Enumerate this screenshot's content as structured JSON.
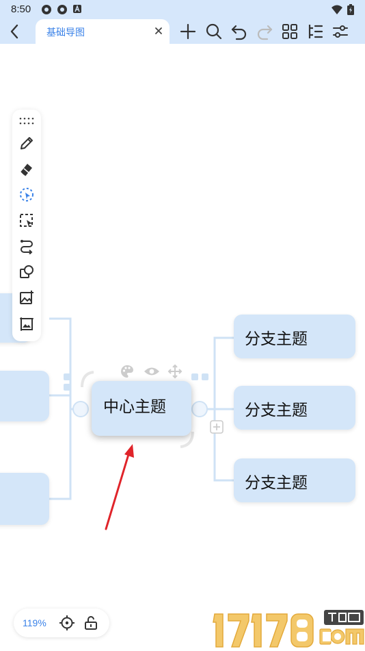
{
  "status_bar": {
    "time": "8:50",
    "left_icons": [
      "settings-gear-icon",
      "settings-gear-icon",
      "text-a-icon"
    ],
    "right_icons": [
      "wifi-icon",
      "battery-icon"
    ]
  },
  "toolbar": {
    "tab_title": "基础导图",
    "buttons": [
      "add-icon",
      "search-icon",
      "undo-icon",
      "redo-icon",
      "grid-icon",
      "outline-icon",
      "settings-icon"
    ]
  },
  "left_toolbar": {
    "items": [
      "drag-handle-icon",
      "pen-icon",
      "eraser-icon",
      "lasso-icon",
      "select-icon",
      "connector-icon",
      "shape-icon",
      "add-image-icon",
      "image-icon"
    ]
  },
  "mindmap": {
    "center_topic": "中心主题",
    "center_tools": [
      "palette-icon",
      "eye-icon",
      "move-icon"
    ],
    "branches": [
      {
        "label": "分支主题"
      },
      {
        "label": "分支主题"
      },
      {
        "label": "分支主题"
      }
    ]
  },
  "zoom": {
    "level": "119%"
  },
  "colors": {
    "accent": "#3a82e8",
    "bar": "#d6e7fb",
    "node": "#d4e6f9",
    "line": "#cfe2f5",
    "arrow": "#e0242a"
  }
}
